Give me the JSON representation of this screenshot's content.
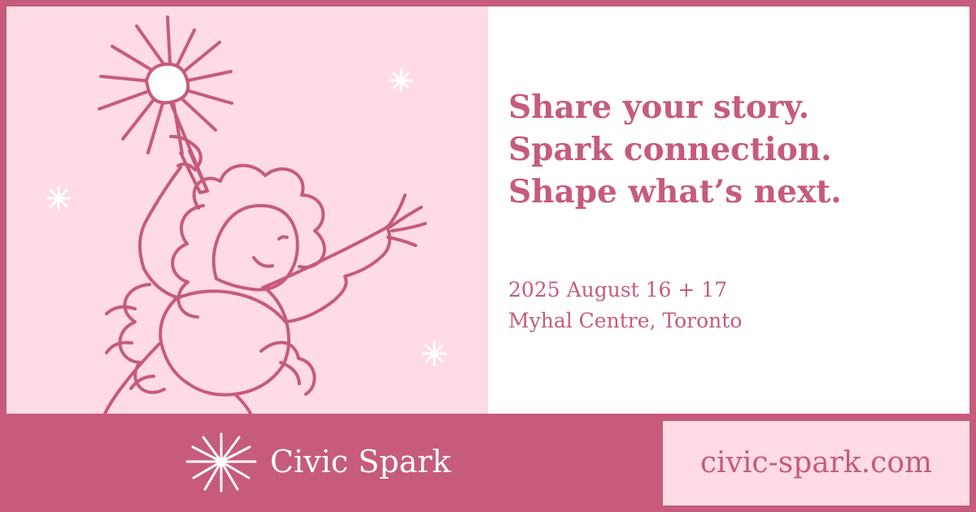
{
  "headline": {
    "line1": "Share your story.",
    "line2": "Spark connection.",
    "line3": "Shape what’s next."
  },
  "event": {
    "dates": "2025 August 16 + 17",
    "venue": "Myhal Centre, Toronto"
  },
  "brand": {
    "name": "Civic Spark",
    "icon": "sparkle-icon"
  },
  "site": {
    "url": "civic-spark.com"
  },
  "colors": {
    "primary_pink": "#c65b7b",
    "light_pink": "#ffdbe5",
    "white": "#ffffff"
  },
  "illustration": {
    "subject": "person-holding-sparkler-illustration"
  }
}
